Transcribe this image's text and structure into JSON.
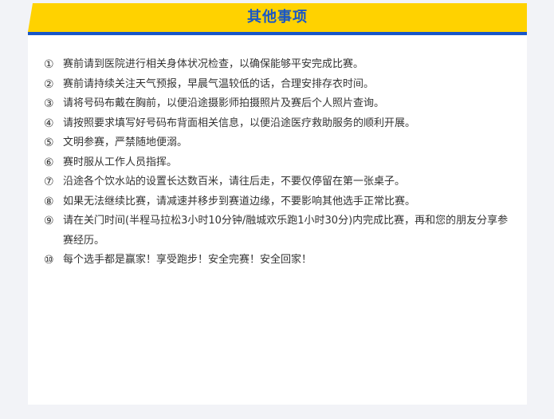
{
  "header": {
    "title": "其他事项"
  },
  "colors": {
    "header_yellow": "#ffd200",
    "header_blue": "#1756c8",
    "text": "#333333",
    "page_bg": "#f2f3f7",
    "card_bg": "#ffffff"
  },
  "items": [
    {
      "num": "①",
      "text": "赛前请到医院进行相关身体状况检查，以确保能够平安完成比赛。"
    },
    {
      "num": "②",
      "text": "赛前请持续关注天气预报，早晨气温较低的话，合理安排存衣时间。"
    },
    {
      "num": "③",
      "text": "请将号码布戴在胸前，以便沿途摄影师拍摄照片及赛后个人照片查询。"
    },
    {
      "num": "④",
      "text": "请按照要求填写好号码布背面相关信息，以便沿途医疗救助服务的顺利开展。"
    },
    {
      "num": "⑤",
      "text": "文明参赛，严禁随地便溺。"
    },
    {
      "num": "⑥",
      "text": "赛时服从工作人员指挥。"
    },
    {
      "num": "⑦",
      "text": "沿途各个饮水站的设置长达数百米，请往后走，不要仅停留在第一张桌子。"
    },
    {
      "num": "⑧",
      "text": "如果无法继续比赛，请减速并移步到赛道边缘，不要影响其他选手正常比赛。"
    },
    {
      "num": "⑨",
      "text": "请在关门时间(半程马拉松3小时10分钟/融城欢乐跑1小时30分)内完成比赛，再和您的朋友分享参赛经历。"
    },
    {
      "num": "⑩",
      "text": "每个选手都是赢家！享受跑步！安全完赛！安全回家！"
    }
  ]
}
